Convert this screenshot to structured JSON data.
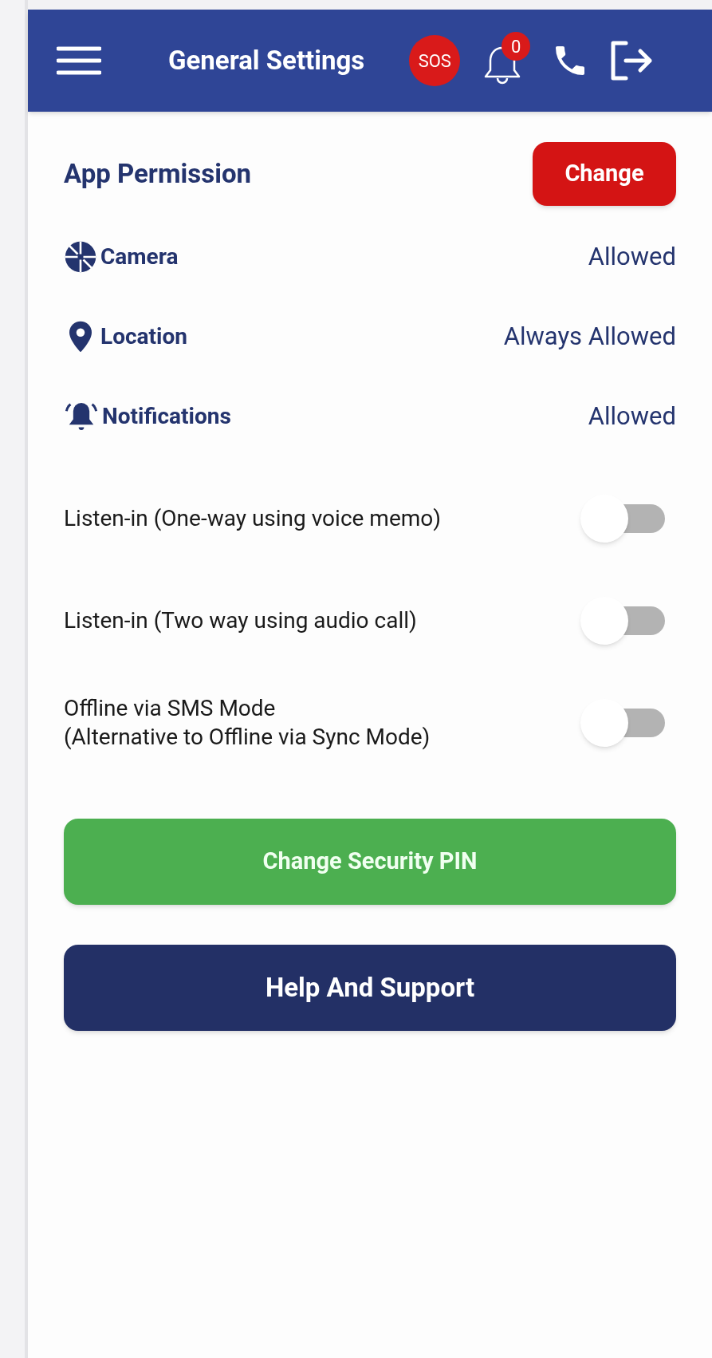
{
  "header": {
    "title": "General Settings",
    "sos": "SOS",
    "notification_count": "0"
  },
  "permissions": {
    "title": "App Permission",
    "change_button": "Change",
    "items": [
      {
        "kind": "camera",
        "label": "Camera",
        "value": "Allowed"
      },
      {
        "kind": "location",
        "label": "Location",
        "value": "Always Allowed"
      },
      {
        "kind": "notifications",
        "label": "Notifications",
        "value": "Allowed"
      }
    ]
  },
  "toggles": [
    {
      "label": "Listen-in (One-way using voice memo)",
      "on": false
    },
    {
      "label": "Listen-in (Two way using audio call)",
      "on": false
    },
    {
      "label": "Offline via SMS Mode\n(Alternative to Offline via Sync Mode)",
      "on": false
    }
  ],
  "buttons": [
    {
      "kind": "primary",
      "label": "Change Security PIN"
    },
    {
      "kind": "secondary",
      "label": "Help And Support"
    }
  ]
}
